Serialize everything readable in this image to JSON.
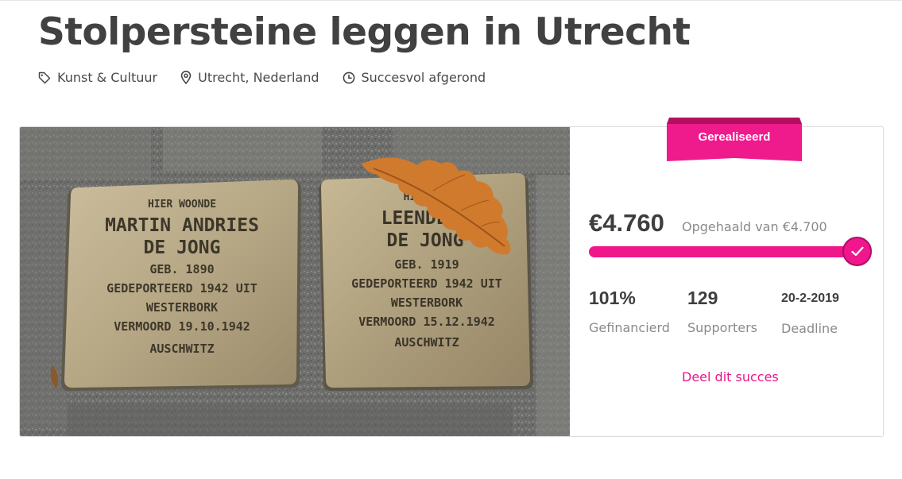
{
  "project": {
    "title": "Stolpersteine leggen in Utrecht",
    "category": "Kunst & Cultuur",
    "location": "Utrecht, Nederland",
    "status": "Succesvol afgerond"
  },
  "photo": {
    "stone_left": [
      "HIER WOONDE",
      "MARTIN ANDRIES",
      "DE JONG",
      "GEB. 1890",
      "GEDEPORTEERD 1942 UIT",
      "WESTERBORK",
      "VERMOORD 19.10.1942",
      "AUSCHWITZ"
    ],
    "stone_right": [
      "HIER WO",
      "LEENDERT",
      "DE JONG",
      "GEB. 1919",
      "GEDEPORTEERD 1942 UIT",
      "WESTERBORK",
      "VERMOORD 15.12.1942",
      "AUSCHWITZ"
    ]
  },
  "funding": {
    "badge": "Gerealiseerd",
    "raised": "€4.760",
    "goal_text": "Opgehaald van €4.700",
    "progress_fraction": 1.0,
    "stats": [
      {
        "value": "101%",
        "label": "Gefinancierd"
      },
      {
        "value": "129",
        "label": "Supporters"
      },
      {
        "value": "20-2-2019",
        "label": "Deadline"
      }
    ],
    "share_label": "Deel dit succes"
  },
  "icons": {
    "category": "tag-icon",
    "location": "location-pin-icon",
    "status": "clock-icon",
    "complete": "checkmark-icon"
  },
  "colors": {
    "accent": "#f0168c",
    "ribbon": "#ef1a8c",
    "title": "#414141",
    "muted": "#8a8a8a"
  }
}
